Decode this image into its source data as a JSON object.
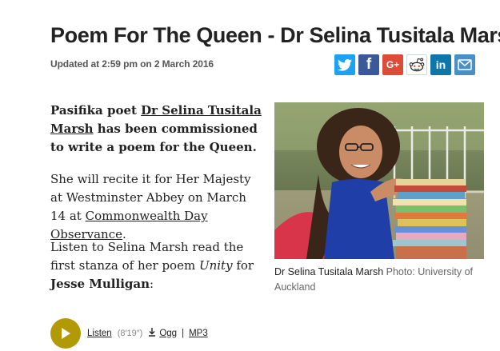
{
  "article": {
    "title": "Poem For The Queen - Dr Selina Tusitala Marsh",
    "updated": "Updated at 2:59 pm on 2 March 2016",
    "lead_1": "Pasifika poet ",
    "lead_link": "Dr Selina Tusitala Marsh",
    "lead_2": " has been commissioned to write a poem for the Queen.",
    "p1_text": "She will recite it for Her Majesty at Westminster Abbey on March 14 at ",
    "p1_link": "Commonwealth Day Observance",
    "p1_end": ".",
    "p2_a": "Listen to Selina Marsh read the first stanza of her poem ",
    "p2_em": "Unity",
    "p2_b": " for ",
    "p2_strong": "Jesse Mulligan",
    "p2_end": ":"
  },
  "share": {
    "twitter": "twitter-icon",
    "facebook": "facebook-icon",
    "googleplus": "google-plus-icon",
    "reddit": "reddit-icon",
    "linkedin": "linkedin-icon",
    "email": "email-icon",
    "facebook_glyph": "f",
    "googleplus_glyph": "G+",
    "linkedin_glyph": "in",
    "colors": {
      "twitter": "#1da1f2",
      "facebook": "#3b5998",
      "googleplus": "#dd4b39",
      "linkedin": "#0e76a8",
      "email": "#4a90c8"
    }
  },
  "image": {
    "caption_name": "Dr Selina Tusitala Marsh",
    "caption_credit": " Photo: University of Auckland"
  },
  "audio": {
    "listen": "Listen",
    "duration": "(8′19″)",
    "ogg": "Ogg",
    "separator": "|",
    "mp3": "MP3",
    "play_color": "#b29a07"
  }
}
